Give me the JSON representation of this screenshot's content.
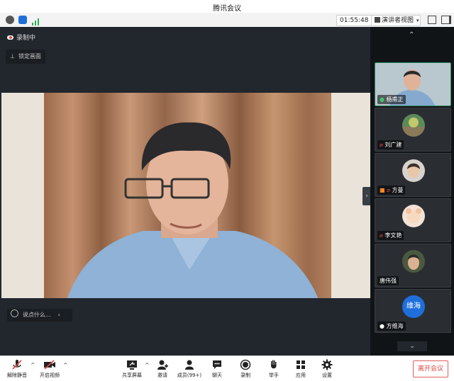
{
  "window": {
    "title": "腾讯会议"
  },
  "infobar": {
    "timer": "01:55:48",
    "view_label": "演讲者视图"
  },
  "main": {
    "recording_label": "录制中",
    "lock_label": "锁定画面",
    "chat_placeholder": "说点什么..."
  },
  "participants": [
    {
      "name": "杨甫正",
      "mic": "on"
    },
    {
      "name": "刘广建",
      "mic": "muted"
    },
    {
      "name": "方曼",
      "mic": "muted"
    },
    {
      "name": "李文艳",
      "mic": "muted"
    },
    {
      "name": "唐伟强",
      "mic": "none"
    },
    {
      "name": "方维海",
      "mic": "on",
      "avatar_text": "维海"
    }
  ],
  "toolbar": {
    "unmute": "解除静音",
    "start_video": "开启视频",
    "share_screen": "共享屏幕",
    "invite": "邀请",
    "members": "成员(99+)",
    "chat": "聊天",
    "record": "录制",
    "raise_hand": "举手",
    "apps": "应用",
    "settings": "设置",
    "leave": "离开会议"
  },
  "colors": {
    "accent": "#1f6fdb",
    "leave": "#e04545",
    "active_border": "#2e8a5a"
  }
}
